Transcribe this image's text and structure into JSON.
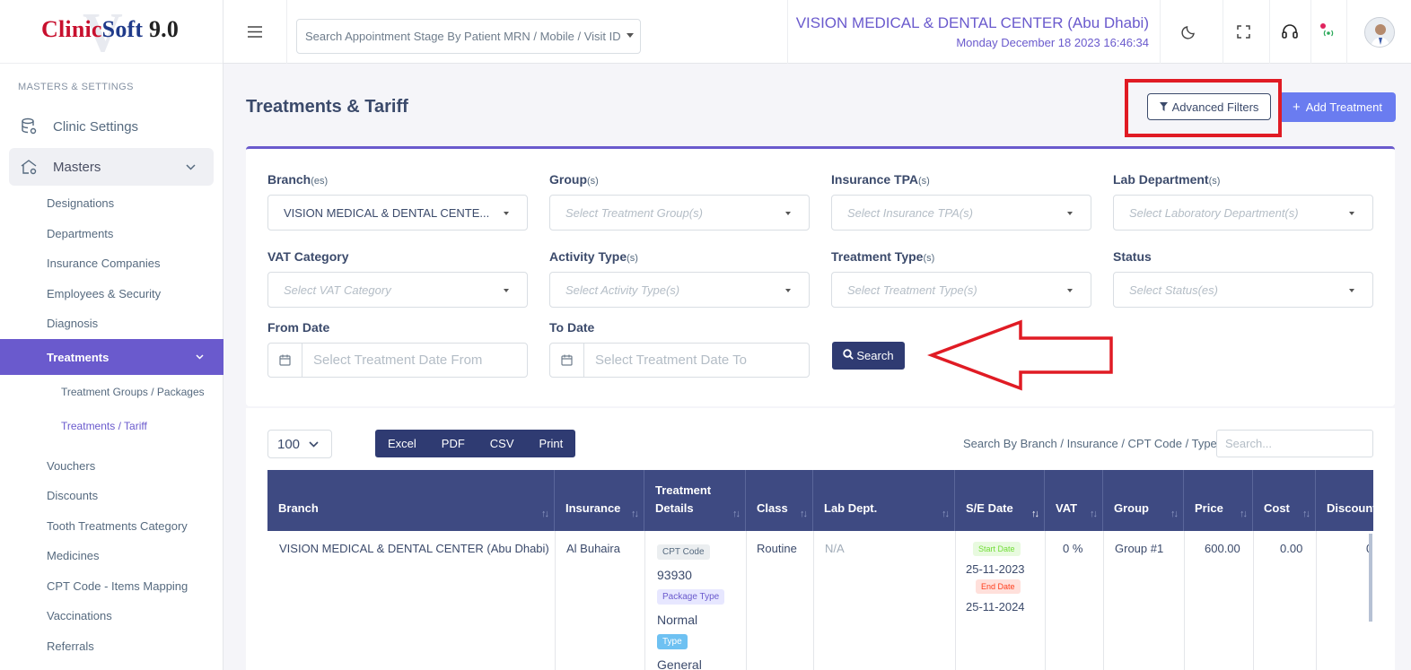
{
  "app": {
    "logo": {
      "part1": "Clinic",
      "part2": "Soft",
      "version": "9.0"
    }
  },
  "sidebar": {
    "section_header": "MASTERS & SETTINGS",
    "clinic_settings": "Clinic Settings",
    "masters": "Masters",
    "sub_items": {
      "designations": "Designations",
      "departments": "Departments",
      "insurance_companies": "Insurance Companies",
      "employees_security": "Employees & Security",
      "diagnosis": "Diagnosis",
      "treatments": "Treatments",
      "treatment_groups": "Treatment Groups / Packages",
      "treatments_tariff": "Treatments / Tariff",
      "vouchers": "Vouchers",
      "discounts": "Discounts",
      "tooth_treatments": "Tooth Treatments Category",
      "medicines": "Medicines",
      "cpt_mapping": "CPT Code - Items Mapping",
      "vaccinations": "Vaccinations",
      "referrals": "Referrals"
    }
  },
  "topbar": {
    "search_placeholder": "Search Appointment Stage By Patient MRN / Mobile / Visit ID",
    "clinic_name": "VISION MEDICAL & DENTAL CENTER (Abu Dhabi)",
    "datetime": "Monday December 18 2023 16:46:34"
  },
  "page": {
    "title": "Treatments & Tariff",
    "advanced_filters": "Advanced Filters",
    "add_treatment": "Add Treatment"
  },
  "filters": {
    "branch": {
      "label": "Branch",
      "suffix": "(es)",
      "value": "VISION MEDICAL & DENTAL CENTE..."
    },
    "group": {
      "label": "Group",
      "suffix": "(s)",
      "placeholder": "Select Treatment Group(s)"
    },
    "insurance_tpa": {
      "label": "Insurance TPA",
      "suffix": "(s)",
      "placeholder": "Select Insurance TPA(s)"
    },
    "lab_department": {
      "label": "Lab Department",
      "suffix": "(s)",
      "placeholder": "Select Laboratory Department(s)"
    },
    "vat_category": {
      "label": "VAT Category",
      "placeholder": "Select VAT Category"
    },
    "activity_type": {
      "label": "Activity Type",
      "suffix": "(s)",
      "placeholder": "Select Activity Type(s)"
    },
    "treatment_type": {
      "label": "Treatment Type",
      "suffix": "(s)",
      "placeholder": "Select Treatment Type(s)"
    },
    "status": {
      "label": "Status",
      "placeholder": "Select Status(es)"
    },
    "from_date": {
      "label": "From Date",
      "placeholder": "Select Treatment Date From"
    },
    "to_date": {
      "label": "To Date",
      "placeholder": "Select Treatment Date To"
    },
    "search_button": "Search"
  },
  "table_controls": {
    "page_length": "100",
    "export_buttons": [
      "Excel",
      "PDF",
      "CSV",
      "Print"
    ],
    "search_label": "Search By Branch / Insurance / CPT Code / Type",
    "search_placeholder": "Search..."
  },
  "table": {
    "columns": [
      "Branch",
      "Insurance",
      "Treatment Details",
      "Class",
      "Lab Dept.",
      "S/E Date",
      "VAT",
      "Group",
      "Price",
      "Cost",
      "Discount"
    ],
    "rows": [
      {
        "branch": "VISION MEDICAL & DENTAL CENTER (Abu Dhabi)",
        "insurance": "Al Buhaira",
        "cpt_code_label": "CPT Code",
        "cpt_code": "93930",
        "package_type_label": "Package Type",
        "package_type": "Normal",
        "type_label": "Type",
        "type": "General",
        "class": "Routine",
        "lab_dept": "N/A",
        "start_date_label": "Start Date",
        "start_date": "25-11-2023",
        "end_date_label": "End Date",
        "end_date": "25-11-2024",
        "vat": "0 %",
        "group": "Group #1",
        "price": "600.00",
        "cost": "0.00",
        "discount": "0"
      }
    ]
  },
  "colors": {
    "primary": "#6a5acd",
    "navy": "#2f3b72",
    "table_header": "#3e4a82",
    "accent_blue": "#6a7cf0",
    "annotation_red": "#e01b24"
  }
}
